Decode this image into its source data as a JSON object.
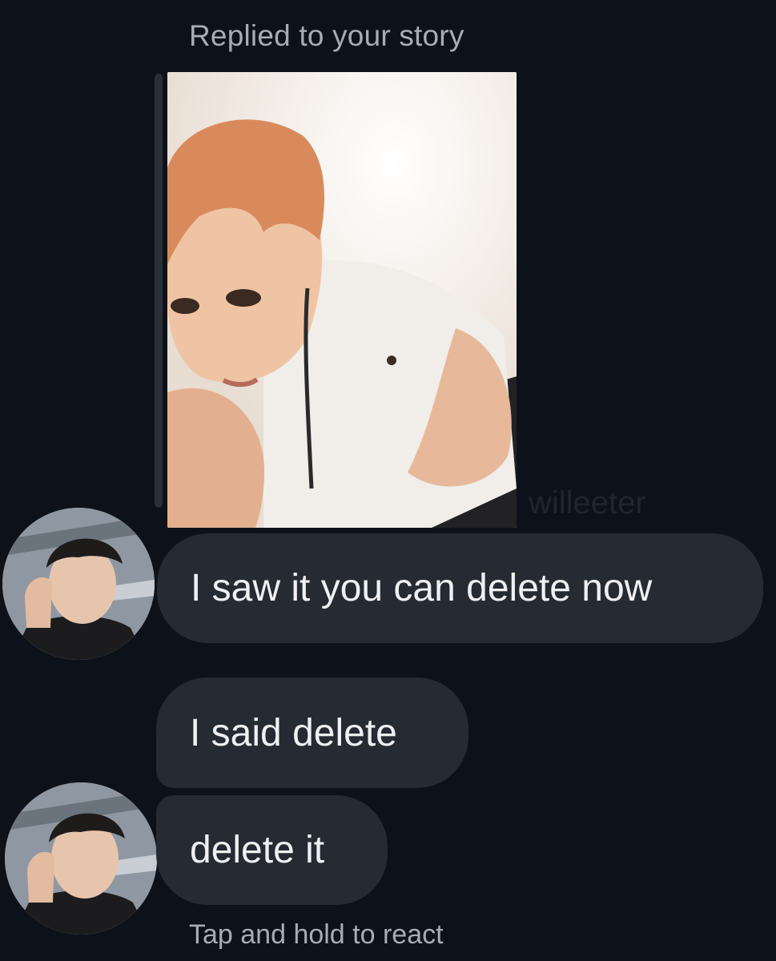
{
  "conversation": {
    "reply_context": "Replied to your story",
    "watermark": "willeeter",
    "messages": [
      {
        "text": "I saw it you can delete now"
      },
      {
        "text": "I said delete"
      },
      {
        "text": "delete it"
      }
    ],
    "hint": "Tap and hold to react"
  },
  "colors": {
    "background": "#0d1119",
    "bubble": "#262a33",
    "secondary_text": "#a8acb4"
  }
}
